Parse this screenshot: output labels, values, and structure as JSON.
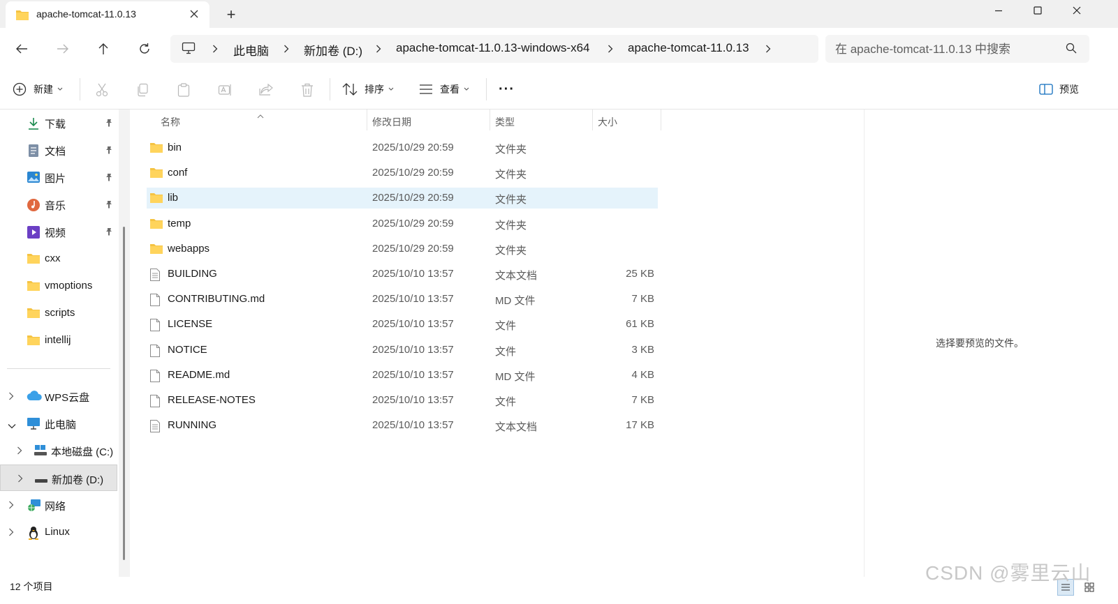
{
  "window": {
    "tab_title": "apache-tomcat-11.0.13",
    "new_tab_symbol": "+"
  },
  "address": {
    "crumbs": [
      "此电脑",
      "新加卷 (D:)",
      "apache-tomcat-11.0.13-windows-x64",
      "apache-tomcat-11.0.13"
    ],
    "search_placeholder": "在 apache-tomcat-11.0.13 中搜索"
  },
  "toolbar": {
    "new_label": "新建",
    "sort_label": "排序",
    "view_label": "查看",
    "more_label": "···",
    "preview_label": "预览"
  },
  "sidebar": {
    "quick_access": [
      {
        "label": "下载",
        "icon": "download-icon",
        "pinned": true
      },
      {
        "label": "文档",
        "icon": "documents-icon",
        "pinned": true
      },
      {
        "label": "图片",
        "icon": "pictures-icon",
        "pinned": true
      },
      {
        "label": "音乐",
        "icon": "music-icon",
        "pinned": true
      },
      {
        "label": "视频",
        "icon": "videos-icon",
        "pinned": true
      },
      {
        "label": "cxx",
        "icon": "folder-icon",
        "pinned": false
      },
      {
        "label": "vmoptions",
        "icon": "folder-icon",
        "pinned": false
      },
      {
        "label": "scripts",
        "icon": "folder-icon",
        "pinned": false
      },
      {
        "label": "intellij",
        "icon": "folder-icon",
        "pinned": false
      }
    ],
    "tree": [
      {
        "label": "WPS云盘",
        "icon": "cloud-icon"
      },
      {
        "label": "此电脑",
        "icon": "computer-icon"
      },
      {
        "label": "本地磁盘 (C:)",
        "icon": "drive-icon"
      },
      {
        "label": "新加卷 (D:)",
        "icon": "drive-icon"
      },
      {
        "label": "网络",
        "icon": "network-icon"
      },
      {
        "label": "Linux",
        "icon": "linux-icon"
      }
    ]
  },
  "columns": {
    "name": "名称",
    "date": "修改日期",
    "type": "类型",
    "size": "大小"
  },
  "files": [
    {
      "name": "bin",
      "date": "2025/10/29 20:59",
      "type": "文件夹",
      "size": "",
      "kind": "folder"
    },
    {
      "name": "conf",
      "date": "2025/10/29 20:59",
      "type": "文件夹",
      "size": "",
      "kind": "folder"
    },
    {
      "name": "lib",
      "date": "2025/10/29 20:59",
      "type": "文件夹",
      "size": "",
      "kind": "folder",
      "selected": true
    },
    {
      "name": "temp",
      "date": "2025/10/29 20:59",
      "type": "文件夹",
      "size": "",
      "kind": "folder"
    },
    {
      "name": "webapps",
      "date": "2025/10/29 20:59",
      "type": "文件夹",
      "size": "",
      "kind": "folder"
    },
    {
      "name": "BUILDING",
      "date": "2025/10/10 13:57",
      "type": "文本文档",
      "size": "25 KB",
      "kind": "text"
    },
    {
      "name": "CONTRIBUTING.md",
      "date": "2025/10/10 13:57",
      "type": "MD 文件",
      "size": "7 KB",
      "kind": "file"
    },
    {
      "name": "LICENSE",
      "date": "2025/10/10 13:57",
      "type": "文件",
      "size": "61 KB",
      "kind": "file"
    },
    {
      "name": "NOTICE",
      "date": "2025/10/10 13:57",
      "type": "文件",
      "size": "3 KB",
      "kind": "file"
    },
    {
      "name": "README.md",
      "date": "2025/10/10 13:57",
      "type": "MD 文件",
      "size": "4 KB",
      "kind": "file"
    },
    {
      "name": "RELEASE-NOTES",
      "date": "2025/10/10 13:57",
      "type": "文件",
      "size": "7 KB",
      "kind": "file"
    },
    {
      "name": "RUNNING",
      "date": "2025/10/10 13:57",
      "type": "文本文档",
      "size": "17 KB",
      "kind": "text"
    }
  ],
  "preview": {
    "message": "选择要预览的文件。"
  },
  "status": {
    "count": "12 个项目",
    "watermark": "CSDN @雾里云山"
  },
  "colors": {
    "selection": "#e5f3fb",
    "folder": "#f5c342",
    "accent": "#0f6cbd"
  }
}
